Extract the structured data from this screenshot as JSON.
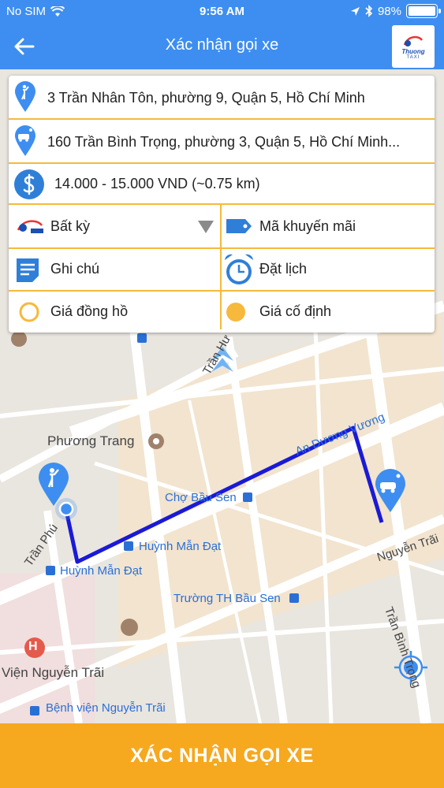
{
  "status": {
    "carrier": "No SIM",
    "time": "9:56 AM",
    "battery": "98%"
  },
  "header": {
    "title": "Xác nhận gọi xe",
    "logo_text": "Thuong",
    "logo_sub": "TAXI"
  },
  "form": {
    "pickup": "3 Trần Nhân Tôn, phường 9, Quận 5, Hồ Chí Minh",
    "destination": "160 Trần Bình Trọng, phường 3, Quận 5, Hồ Chí Minh...",
    "fare": "14.000 - 15.000 VND (~0.75 km)",
    "car_type": "Bất kỳ",
    "promo_placeholder": "Mã khuyến mãi",
    "note_placeholder": "Ghi chú",
    "schedule_placeholder": "Đặt lịch",
    "meter_price": "Giá đồng hồ",
    "fixed_price": "Giá cố định"
  },
  "map": {
    "labels": {
      "phuong_trang": "Phương Trang",
      "cho_bau_sen": "Chợ Bầu Sen",
      "huynh_man_dat_1": "Huỳnh Mẫn Đạt",
      "huynh_man_dat_2": "Huỳnh Mẫn Đạt",
      "truong_bau_sen": "Trường TH Bầu Sen",
      "an_duong_vuong": "An Dương Vương",
      "nguyen_trai": "Nguyễn Trãi",
      "tran_phu": "Trần Phú",
      "tran_binh_trong": "Trần Bình Trọng",
      "tran_hung": "Trần Hư",
      "vien_nguyen_trai": "Viện Nguyễn Trãi",
      "benh_vien": "Bệnh viện Nguyễn Trãi"
    }
  },
  "confirm_label": "XÁC NHẬN GỌI XE",
  "colors": {
    "primary": "#3d8ef0",
    "accent": "#f6a81f",
    "route": "#1a1ad6",
    "divider": "#f6b93b"
  }
}
